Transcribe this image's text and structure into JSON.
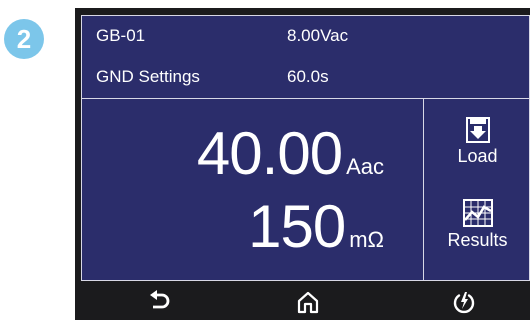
{
  "step_badge": "2",
  "header": {
    "test_name": "GB-01",
    "test_voltage": "8.00Vac",
    "settings_label": "GND Settings",
    "test_time": "60.0s"
  },
  "readings": {
    "current_value": "40.00",
    "current_unit": "Aac",
    "resistance_value": "150",
    "resistance_unit": "mΩ"
  },
  "side_buttons": {
    "load_label": "Load",
    "results_label": "Results"
  },
  "bottom_nav": {
    "icons": [
      "back-arrow-icon",
      "home-icon",
      "power-icon"
    ]
  },
  "colors": {
    "screen_bg": "#2b2d6b",
    "device_frame": "#1b1b1d",
    "badge": "#7cc6ea",
    "text": "#ffffff"
  }
}
